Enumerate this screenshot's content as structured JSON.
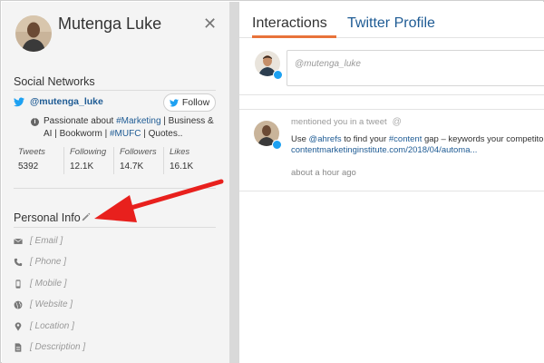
{
  "profile": {
    "name": "Mutenga Luke",
    "close_glyph": "✕"
  },
  "social": {
    "section_title": "Social Networks",
    "handle": "@mutenga_luke",
    "follow_label": "Follow",
    "bio_prefix": "Passionate about ",
    "bio_tag1": "#Marketing",
    "bio_mid": " | Business & AI | Bookworm | ",
    "bio_tag2": "#MUFC",
    "bio_suffix": " | Quotes..",
    "stats": [
      {
        "label": "Tweets",
        "value": "5392"
      },
      {
        "label": "Following",
        "value": "12.1K"
      },
      {
        "label": "Followers",
        "value": "14.7K"
      },
      {
        "label": "Likes",
        "value": "16.1K"
      }
    ]
  },
  "personal_info": {
    "section_title": "Personal Info",
    "fields": [
      {
        "icon": "envelope-icon",
        "text": "[ Email ]"
      },
      {
        "icon": "phone-icon",
        "text": "[ Phone ]"
      },
      {
        "icon": "mobile-icon",
        "text": "[ Mobile ]"
      },
      {
        "icon": "globe-icon",
        "text": "[ Website ]"
      },
      {
        "icon": "location-pin-icon",
        "text": "[ Location ]"
      },
      {
        "icon": "document-icon",
        "text": "[ Description ]"
      }
    ]
  },
  "tabs": [
    {
      "label": "Interactions",
      "active": true
    },
    {
      "label": "Twitter Profile",
      "active": false
    }
  ],
  "compose": {
    "placeholder": "@mutenga_luke"
  },
  "feed": [
    {
      "header": "mentioned you in a tweet",
      "text_prefix": "Use ",
      "mention": "@ahrefs",
      "text_mid": " to find your ",
      "hashtag": "#content",
      "text_suffix": " gap – keywords your competitors ra",
      "url": "contentmarketinginstitute.com/2018/04/automa...",
      "time": "about a hour ago"
    }
  ],
  "colors": {
    "accent_orange": "#e8733a",
    "link_blue": "#1e5b94",
    "twitter_blue": "#1da1f2",
    "arrow_red": "#e8201d",
    "panel_gray": "#f4f4f4"
  }
}
